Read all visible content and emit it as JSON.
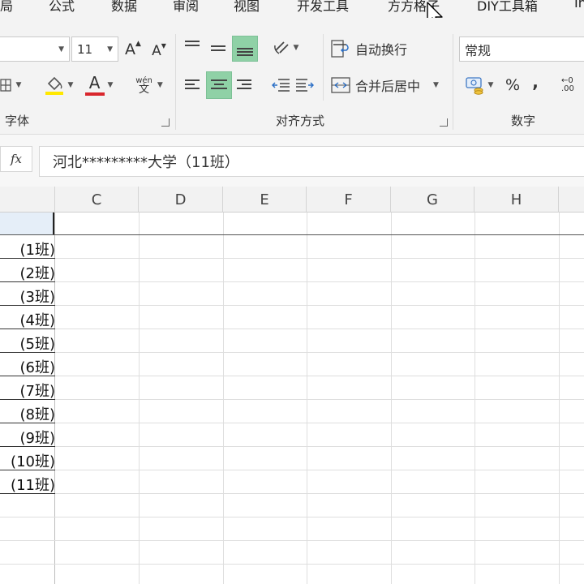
{
  "menu": {
    "items": [
      "局",
      "公式",
      "数据",
      "审阅",
      "视图",
      "开发工具",
      "方方格子",
      "DIY工具箱",
      "In"
    ]
  },
  "ribbon": {
    "font_size": "11",
    "font_group_label": "字体",
    "align_group_label": "对齐方式",
    "number_group_label": "数字",
    "wrap_text": "自动换行",
    "merge_center": "合并后居中",
    "number_format": "常规",
    "percent": "%",
    "comma": ",",
    "increase_font": "A",
    "decrease_font": "A",
    "font_color_glyph": "A",
    "phonetic_top": "wén",
    "phonetic_bottom": "文",
    "decimal_glyph": "←0 .00"
  },
  "formula_bar": {
    "fx": "fx",
    "content": "河北*********大学（11班）"
  },
  "sheet": {
    "columns": [
      "C",
      "D",
      "E",
      "F",
      "G",
      "H"
    ],
    "cells": [
      "(1班)",
      "(2班)",
      "(3班)",
      "(4班)",
      "(5班)",
      "(6班)",
      "(7班)",
      "(8班)",
      "(9班)",
      "(10班)",
      "(11班)"
    ]
  },
  "colors": {
    "selected_button": "#8fd1a6",
    "font_color_bar": "#d9262c",
    "fill_color_bar": "#ffe800"
  },
  "icons": [
    "paint-bucket-icon",
    "cursor-icon",
    "currency-icon",
    "indent-icon",
    "wrap-icon",
    "merge-icon",
    "orientation-icon"
  ]
}
